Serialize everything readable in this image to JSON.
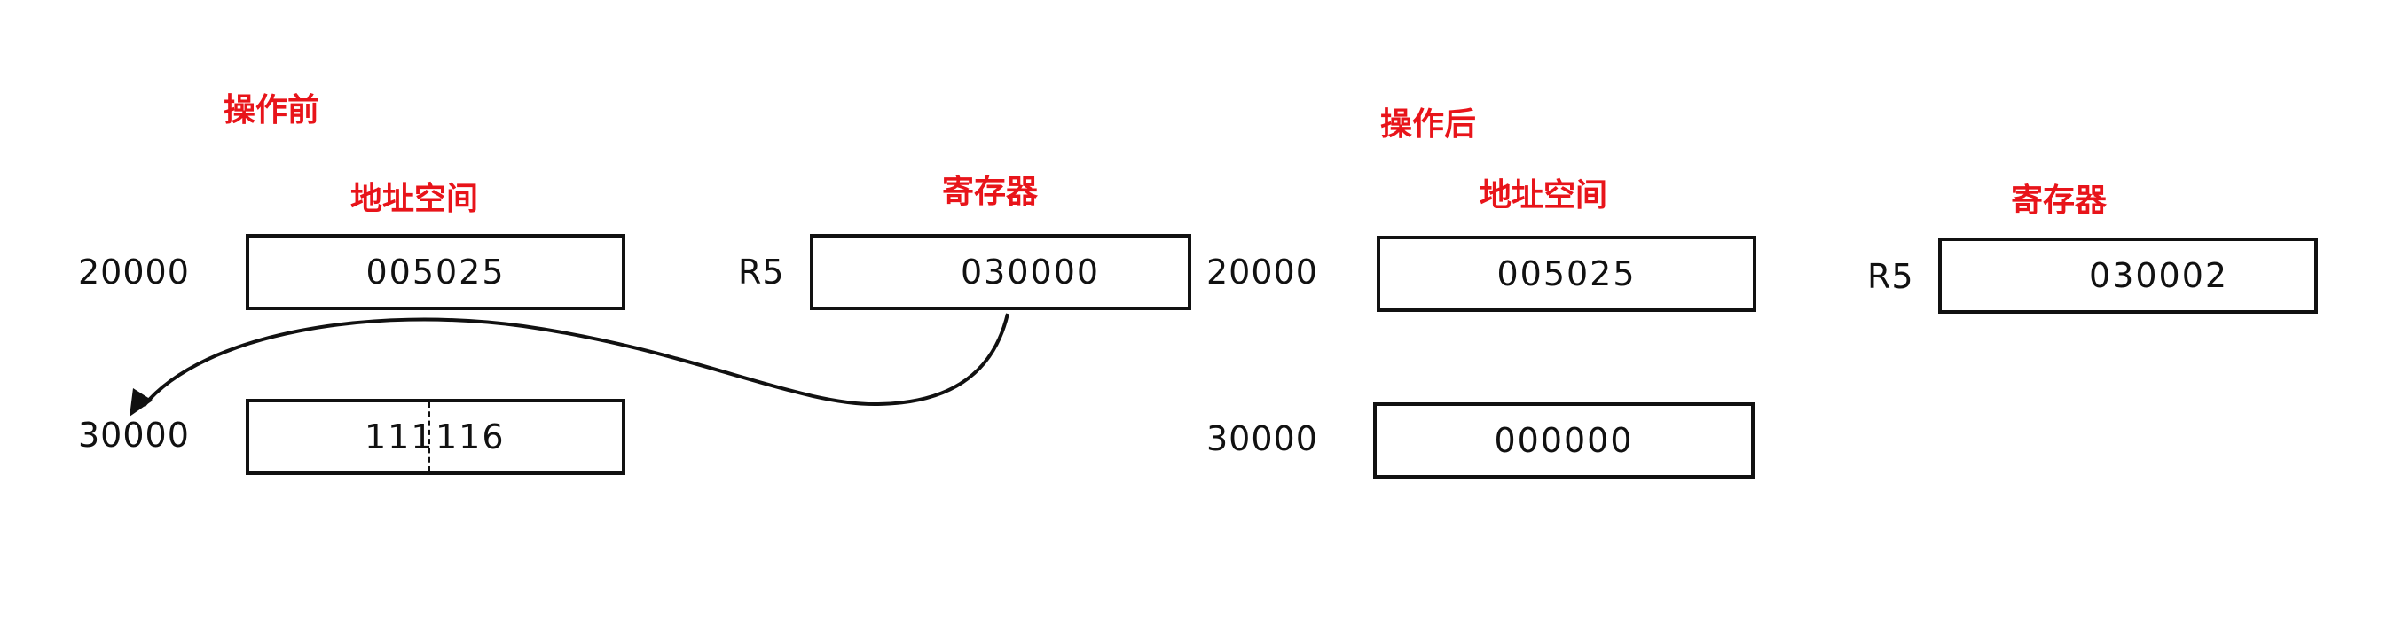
{
  "colors": {
    "heading": "#e8141a",
    "ink": "#111111",
    "background": "#ffffff"
  },
  "before": {
    "title": "操作前",
    "memory_heading": "地址空间",
    "register_heading": "寄存器",
    "memory": [
      {
        "address": "20000",
        "value": "005025"
      },
      {
        "address": "30000",
        "value_left": "111",
        "value_right": "116"
      }
    ],
    "register": {
      "name": "R5",
      "value": "030000"
    }
  },
  "after": {
    "title": "操作后",
    "memory_heading": "地址空间",
    "register_heading": "寄存器",
    "memory": [
      {
        "address": "20000",
        "value": "005025"
      },
      {
        "address": "30000",
        "value": "000000"
      }
    ],
    "register": {
      "name": "R5",
      "value": "030002"
    }
  },
  "icons": {
    "pointer_arrow": "curved-arrow-icon"
  }
}
